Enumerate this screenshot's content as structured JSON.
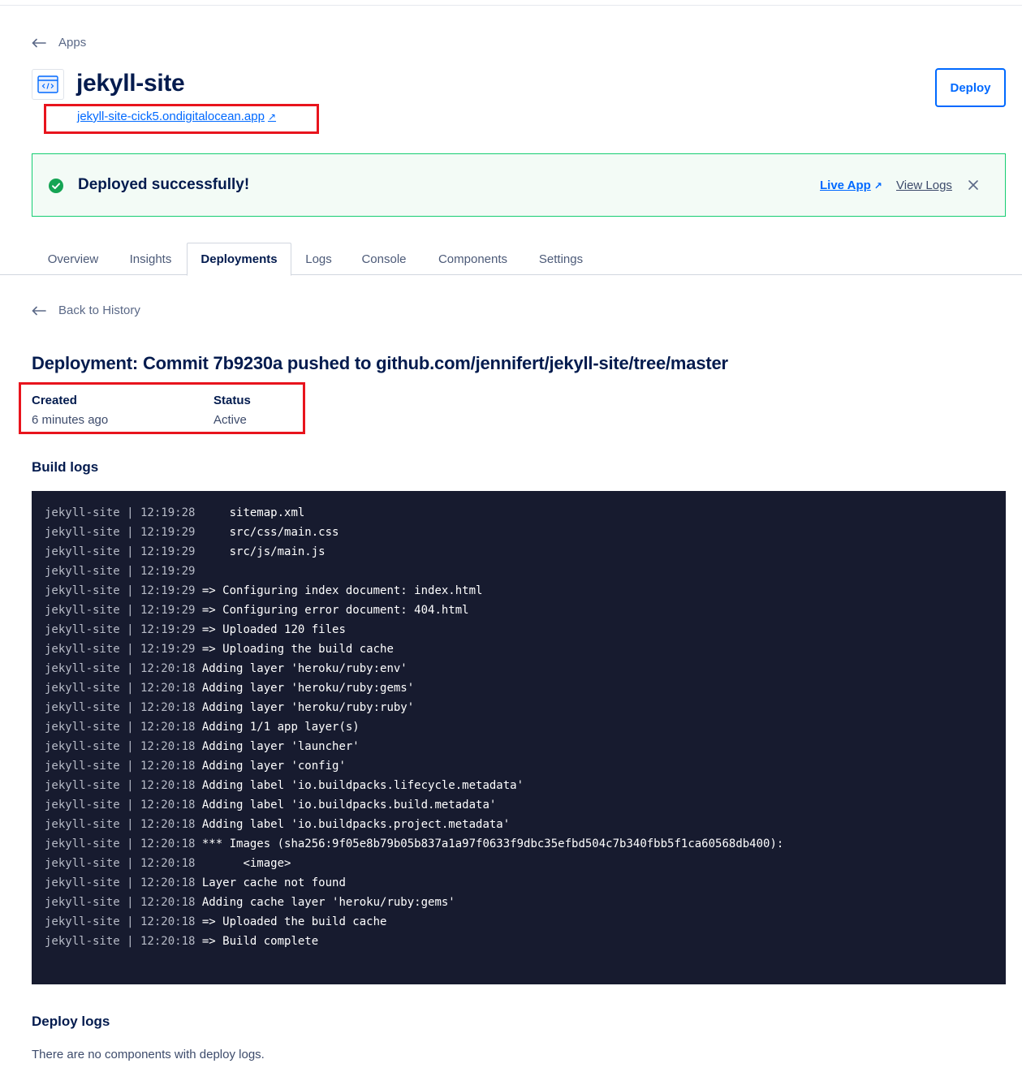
{
  "nav": {
    "back_apps": "Apps",
    "back_history": "Back to History"
  },
  "app": {
    "title": "jekyll-site",
    "url": "jekyll-site-cick5.ondigitalocean.app",
    "deploy_button": "Deploy"
  },
  "banner": {
    "message": "Deployed successfully!",
    "live_app": "Live App",
    "view_logs": "View Logs"
  },
  "tabs": [
    "Overview",
    "Insights",
    "Deployments",
    "Logs",
    "Console",
    "Components",
    "Settings"
  ],
  "active_tab": "Deployments",
  "deployment": {
    "heading": "Deployment: Commit 7b9230a pushed to github.com/jennifert/jekyll-site/tree/master",
    "created_label": "Created",
    "created_value": "6 minutes ago",
    "status_label": "Status",
    "status_value": "Active"
  },
  "build_logs": {
    "title": "Build logs",
    "lines": [
      {
        "prefix": "jekyll-site | 12:19:28",
        "msg": "    sitemap.xml"
      },
      {
        "prefix": "jekyll-site | 12:19:29",
        "msg": "    src/css/main.css"
      },
      {
        "prefix": "jekyll-site | 12:19:29",
        "msg": "    src/js/main.js"
      },
      {
        "prefix": "jekyll-site | 12:19:29",
        "msg": ""
      },
      {
        "prefix": "jekyll-site | 12:19:29",
        "msg": "=> Configuring index document: index.html"
      },
      {
        "prefix": "jekyll-site | 12:19:29",
        "msg": "=> Configuring error document: 404.html"
      },
      {
        "prefix": "jekyll-site | 12:19:29",
        "msg": "=> Uploaded 120 files"
      },
      {
        "prefix": "jekyll-site | 12:19:29",
        "msg": "=> Uploading the build cache"
      },
      {
        "prefix": "jekyll-site | 12:20:18",
        "msg": "Adding layer 'heroku/ruby:env'"
      },
      {
        "prefix": "jekyll-site | 12:20:18",
        "msg": "Adding layer 'heroku/ruby:gems'"
      },
      {
        "prefix": "jekyll-site | 12:20:18",
        "msg": "Adding layer 'heroku/ruby:ruby'"
      },
      {
        "prefix": "jekyll-site | 12:20:18",
        "msg": "Adding 1/1 app layer(s)"
      },
      {
        "prefix": "jekyll-site | 12:20:18",
        "msg": "Adding layer 'launcher'"
      },
      {
        "prefix": "jekyll-site | 12:20:18",
        "msg": "Adding layer 'config'"
      },
      {
        "prefix": "jekyll-site | 12:20:18",
        "msg": "Adding label 'io.buildpacks.lifecycle.metadata'"
      },
      {
        "prefix": "jekyll-site | 12:20:18",
        "msg": "Adding label 'io.buildpacks.build.metadata'"
      },
      {
        "prefix": "jekyll-site | 12:20:18",
        "msg": "Adding label 'io.buildpacks.project.metadata'"
      },
      {
        "prefix": "jekyll-site | 12:20:18",
        "msg": "*** Images (sha256:9f05e8b79b05b837a1a97f0633f9dbc35efbd504c7b340fbb5f1ca60568db400):"
      },
      {
        "prefix": "jekyll-site | 12:20:18",
        "msg": "      <image>"
      },
      {
        "prefix": "jekyll-site | 12:20:18",
        "msg": "Layer cache not found"
      },
      {
        "prefix": "jekyll-site | 12:20:18",
        "msg": "Adding cache layer 'heroku/ruby:gems'"
      },
      {
        "prefix": "jekyll-site | 12:20:18",
        "msg": "=> Uploaded the build cache"
      },
      {
        "prefix": "jekyll-site | 12:20:18",
        "msg": "=> Build complete"
      }
    ]
  },
  "deploy_logs": {
    "title": "Deploy logs",
    "empty_message": "There are no components with deploy logs."
  },
  "colors": {
    "accent": "#0069ff",
    "success": "#15cd72",
    "highlight": "#e8141d",
    "terminal_bg": "#171b2f"
  }
}
